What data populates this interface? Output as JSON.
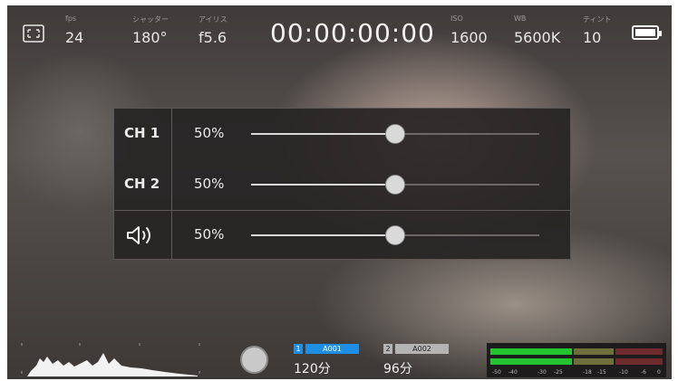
{
  "top_bar": {
    "fps": {
      "label": "fps",
      "value": "24"
    },
    "shutter": {
      "label": "シャッター",
      "value": "180°"
    },
    "iris": {
      "label": "アイリス",
      "value": "f5.6"
    },
    "timecode": "00:00:00:00",
    "iso": {
      "label": "ISO",
      "value": "1600"
    },
    "white_balance": {
      "label": "WB",
      "value": "5600K"
    },
    "tint": {
      "label": "ティント",
      "value": "10"
    },
    "battery_icon": "battery-full-icon",
    "focus_icon": "focus-frame-icon"
  },
  "audio_panel": {
    "rows": [
      {
        "label": "CH 1",
        "value": "50%",
        "level": 0.5
      },
      {
        "label": "CH 2",
        "value": "50%",
        "level": 0.5
      },
      {
        "icon": "speaker-icon",
        "value": "50%",
        "level": 0.5
      }
    ]
  },
  "bottom_bar": {
    "histogram_icon": "histogram",
    "record_button_icon": "record-icon",
    "slot1": {
      "number": "1",
      "clip": "A001",
      "time": "120分",
      "active": true
    },
    "slot2": {
      "number": "2",
      "clip": "A002",
      "time": "96分",
      "active": false
    },
    "meter_scale": [
      "-50",
      "-40",
      "-30",
      "-25",
      "-18",
      "-15",
      "-10",
      "-6",
      "0"
    ]
  },
  "colors": {
    "slot_active": "#1f8fe6",
    "slot_inactive": "#b4b4b4",
    "meter_green": "#23c432",
    "meter_yellow": "#6e6f3a",
    "meter_red": "#6e2a2c"
  }
}
